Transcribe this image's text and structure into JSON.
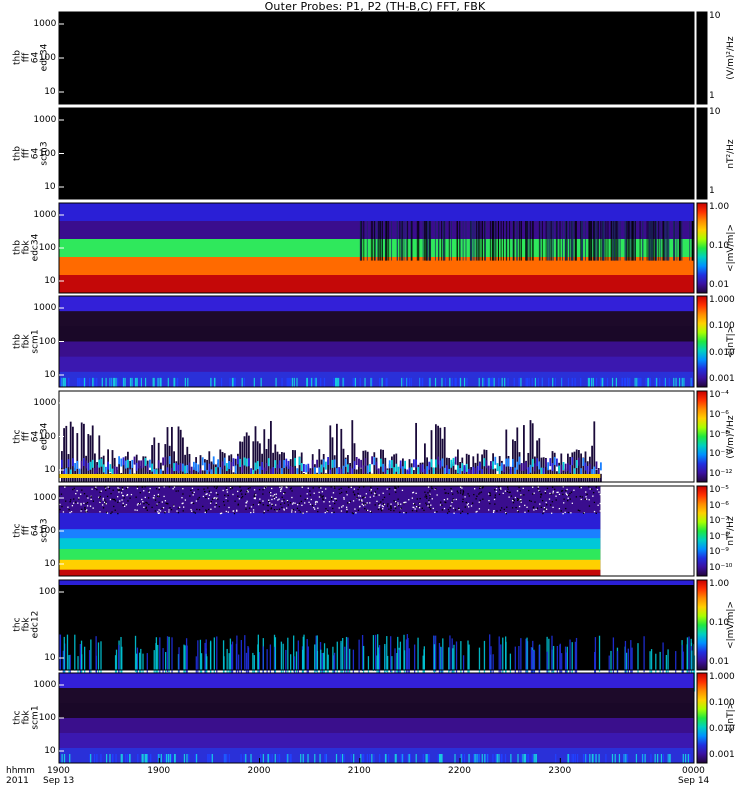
{
  "title": "Outer Probes: P1, P2 (TH-B,C) FFT, FBK",
  "x_axis": {
    "row_labels": [
      "hhmm",
      "2011"
    ],
    "ticks": [
      {
        "t": 0,
        "label": "1900",
        "sub": "Sep 13"
      },
      {
        "t": 60,
        "label": "1900",
        "sub": ""
      },
      {
        "t": 120,
        "label": "2000",
        "sub": ""
      },
      {
        "t": 180,
        "label": "2100",
        "sub": ""
      },
      {
        "t": 240,
        "label": "2200",
        "sub": ""
      },
      {
        "t": 300,
        "label": "2300",
        "sub": ""
      },
      {
        "t": 380,
        "label": "0000",
        "sub": "Sep 14"
      }
    ]
  },
  "panels": [
    {
      "id": "thb-fff-edc34",
      "ylabel": [
        "thb",
        "fff",
        "64",
        "edc34"
      ],
      "yticks": [
        "1000",
        "100",
        "10"
      ],
      "cb_ticks": [
        "10",
        "1"
      ],
      "cb_unit": "(V/m)²/Hz",
      "style": "black"
    },
    {
      "id": "thb-fff-scm3",
      "ylabel": [
        "thb",
        "fff",
        "64",
        "scm3"
      ],
      "yticks": [
        "1000",
        "100",
        "10"
      ],
      "cb_ticks": [
        "10",
        "1"
      ],
      "cb_unit": "nT²/Hz",
      "style": "black"
    },
    {
      "id": "thb-fbk-edc34",
      "ylabel": [
        "thb",
        "fbk",
        "edc34"
      ],
      "yticks": [
        "1000",
        "100",
        "10"
      ],
      "cb_ticks": [
        "1.00",
        "0.10",
        "0.01"
      ],
      "cb_unit": "<|mV/m|>",
      "style": "bands",
      "bands": [
        "#2a1fd6",
        "#3a0d8e",
        "#2fe85c",
        "#ff6a00",
        "#c40808"
      ]
    },
    {
      "id": "thb-fbk-scm1",
      "ylabel": [
        "thb",
        "fbk",
        "scm1"
      ],
      "yticks": [
        "1000",
        "100",
        "10"
      ],
      "cb_ticks": [
        "1.000",
        "0.100",
        "0.010",
        "0.001"
      ],
      "cb_unit": "<|nT|>",
      "style": "dark_bands",
      "bands": [
        "#3320d8",
        "#1d0a2a",
        "#1a0828",
        "#3a0f8c",
        "#3b18b0",
        "#2a30d8"
      ]
    },
    {
      "id": "thc-fff-edc34",
      "ylabel": [
        "thc",
        "fff",
        "64",
        "edc34"
      ],
      "yticks": [
        "1000",
        "100",
        "10"
      ],
      "cb_ticks": [
        "10⁻⁴",
        "10⁻⁶",
        "10⁻⁸",
        "10⁻¹⁰",
        "10⁻¹²"
      ],
      "cb_unit": "(V/m)²/Hz",
      "style": "spikes"
    },
    {
      "id": "thc-fff-scm3",
      "ylabel": [
        "thc",
        "fff",
        "64",
        "scm3"
      ],
      "yticks": [
        "1000",
        "100",
        "10"
      ],
      "cb_ticks": [
        "10⁻⁵",
        "10⁻⁶",
        "10⁻⁷",
        "10⁻⁸",
        "10⁻⁹",
        "10⁻¹⁰"
      ],
      "cb_unit": "nT²/Hz",
      "style": "noise"
    },
    {
      "id": "thc-fbk-edc12",
      "ylabel": [
        "thc",
        "fbk",
        "edc12"
      ],
      "yticks": [
        "100",
        "10"
      ],
      "cb_ticks": [
        "1.00",
        "0.10",
        "0.01"
      ],
      "cb_unit": "<|mV/m|>",
      "style": "sparse"
    },
    {
      "id": "thc-fbk-scm1",
      "ylabel": [
        "thc",
        "fbk",
        "scm1"
      ],
      "yticks": [
        "1000",
        "100",
        "10"
      ],
      "cb_ticks": [
        "1.000",
        "0.100",
        "0.010",
        "0.001"
      ],
      "cb_unit": "<|nT|>",
      "style": "dark_bands",
      "bands": [
        "#3320d8",
        "#1d0a2a",
        "#1a0828",
        "#3a0f8c",
        "#3b18b0",
        "#2a30d8"
      ]
    }
  ],
  "chart_data": {
    "type": "heatmap",
    "title": "Outer Probes: P1, P2 (TH-B,C) FFT, FBK",
    "x_range": [
      "1900 Sep 13 2011",
      "0000 Sep 14 2011"
    ],
    "y_scale": "log",
    "colorscale": "rainbow",
    "panels": [
      {
        "name": "thb fff 64 edc34",
        "unit": "(V/m)²/Hz",
        "cb_range": [
          "1",
          "10"
        ],
        "content": "no data (black)"
      },
      {
        "name": "thb fff 64 scm3",
        "unit": "nT²/Hz",
        "cb_range": [
          "1",
          "10"
        ],
        "content": "no data (black)"
      },
      {
        "name": "thb fbk edc34",
        "unit": "<|mV/m|>",
        "cb_range": [
          "0.01",
          "1.00"
        ]
      },
      {
        "name": "thb fbk scm1",
        "unit": "<|nT|>",
        "cb_range": [
          "0.001",
          "1.000"
        ]
      },
      {
        "name": "thc fff 64 edc34",
        "unit": "(V/m)²/Hz",
        "cb_range": [
          "10⁻¹²",
          "10⁻⁴"
        ]
      },
      {
        "name": "thc fff 64 scm3",
        "unit": "nT²/Hz",
        "cb_range": [
          "10⁻¹⁰",
          "10⁻⁵"
        ]
      },
      {
        "name": "thc fbk edc12",
        "unit": "<|mV/m|>",
        "cb_range": [
          "0.01",
          "1.00"
        ]
      },
      {
        "name": "thc fbk scm1",
        "unit": "<|nT|>",
        "cb_range": [
          "0.001",
          "1.000"
        ]
      }
    ]
  }
}
